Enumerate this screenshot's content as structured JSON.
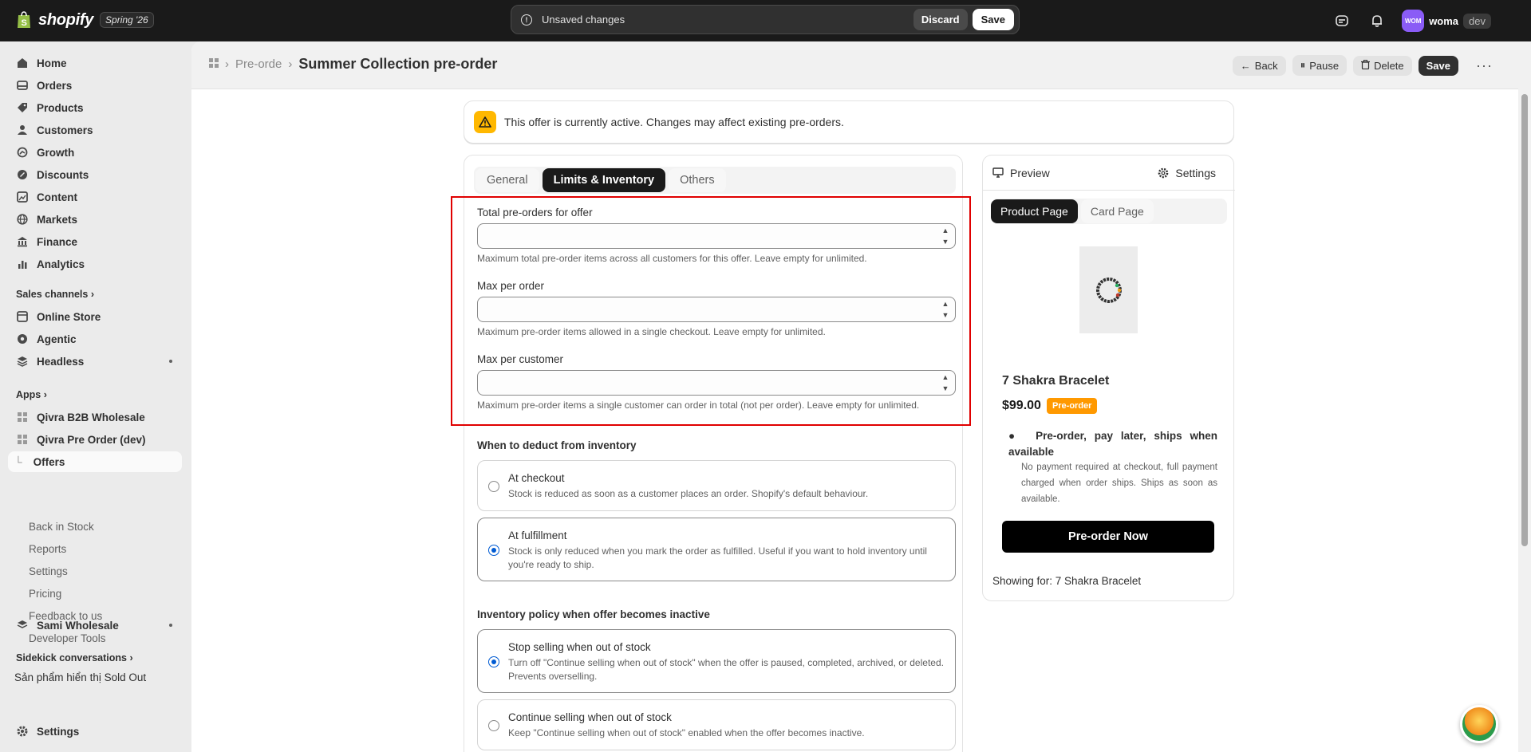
{
  "topbar": {
    "brand": "shopify",
    "edition": "Spring '26",
    "unsaved_text": "Unsaved changes",
    "discard_label": "Discard",
    "save_label": "Save",
    "user_initials": "WOM",
    "user_name": "woma",
    "env_badge": "dev"
  },
  "sidebar": {
    "items": [
      {
        "label": "Home",
        "icon": "home-icon"
      },
      {
        "label": "Orders",
        "icon": "orders-icon"
      },
      {
        "label": "Products",
        "icon": "tag-icon"
      },
      {
        "label": "Customers",
        "icon": "person-icon"
      },
      {
        "label": "Growth",
        "icon": "growth-icon"
      },
      {
        "label": "Discounts",
        "icon": "discount-icon"
      },
      {
        "label": "Content",
        "icon": "content-icon"
      },
      {
        "label": "Markets",
        "icon": "globe-icon"
      },
      {
        "label": "Finance",
        "icon": "bank-icon"
      },
      {
        "label": "Analytics",
        "icon": "chart-icon"
      }
    ],
    "sales_channels_label": "Sales channels",
    "channels": [
      {
        "label": "Online Store",
        "icon": "store-icon"
      },
      {
        "label": "Agentic",
        "icon": "agentic-icon"
      },
      {
        "label": "Headless",
        "icon": "headless-icon"
      }
    ],
    "apps_label": "Apps",
    "apps": [
      {
        "label": "Qivra B2B Wholesale"
      },
      {
        "label": "Qivra Pre Order (dev)"
      }
    ],
    "app_subitems": [
      "Offers",
      "Back in Stock",
      "Reports",
      "Settings",
      "Pricing",
      "Feedback to us",
      "Developer Tools"
    ],
    "sami_label": "Sami Wholesale",
    "sidekick_label": "Sidekick conversations",
    "sidekick_item": "Sản phẩm hiển thị Sold Out",
    "settings_label": "Settings"
  },
  "header": {
    "crumb_parent": "Pre-orde",
    "title": "Summer Collection pre-order",
    "back_label": "Back",
    "pause_label": "Pause",
    "delete_label": "Delete",
    "save_label": "Save"
  },
  "banner": {
    "text": "This offer is currently active. Changes may affect existing pre-orders."
  },
  "tabs": [
    "General",
    "Limits & Inventory",
    "Others"
  ],
  "limits": {
    "total": {
      "label": "Total pre-orders for offer",
      "value": "",
      "help": "Maximum total pre-order items across all customers for this offer. Leave empty for unlimited."
    },
    "per_order": {
      "label": "Max per order",
      "value": "",
      "help": "Maximum pre-order items allowed in a single checkout. Leave empty for unlimited."
    },
    "per_customer": {
      "label": "Max per customer",
      "value": "",
      "help": "Maximum pre-order items a single customer can order in total (not per order). Leave empty for unlimited."
    }
  },
  "deduct": {
    "heading": "When to deduct from inventory",
    "options": [
      {
        "title": "At checkout",
        "desc": "Stock is reduced as soon as a customer places an order. Shopify's default behaviour.",
        "selected": false
      },
      {
        "title": "At fulfillment",
        "desc": "Stock is only reduced when you mark the order as fulfilled. Useful if you want to hold inventory until you're ready to ship.",
        "selected": true
      }
    ]
  },
  "policy": {
    "heading": "Inventory policy when offer becomes inactive",
    "options": [
      {
        "title": "Stop selling when out of stock",
        "desc": "Turn off \"Continue selling when out of stock\" when the offer is paused, completed, archived, or deleted. Prevents overselling.",
        "selected": true
      },
      {
        "title": "Continue selling when out of stock",
        "desc": "Keep \"Continue selling when out of stock\" enabled when the offer becomes inactive.",
        "selected": false
      }
    ]
  },
  "preview": {
    "preview_label": "Preview",
    "settings_label": "Settings",
    "tabs": [
      "Product Page",
      "Card Page"
    ],
    "product_name": "7 Shakra Bracelet",
    "price": "$99.00",
    "badge": "Pre-order",
    "bullet": "Pre-order, pay later, ships when available",
    "bullet_sub": "No payment required at checkout, full payment charged when order ships. Ships as soon as available.",
    "cta": "Pre-order Now",
    "showing_for": "Showing for: 7 Shakra Bracelet"
  },
  "colors": {
    "topbar_bg": "#1a1a1a",
    "accent_radio": "#005bd3",
    "warning": "#ffb800",
    "pre_order_badge": "#ff9900",
    "highlight_border": "#e00000"
  }
}
